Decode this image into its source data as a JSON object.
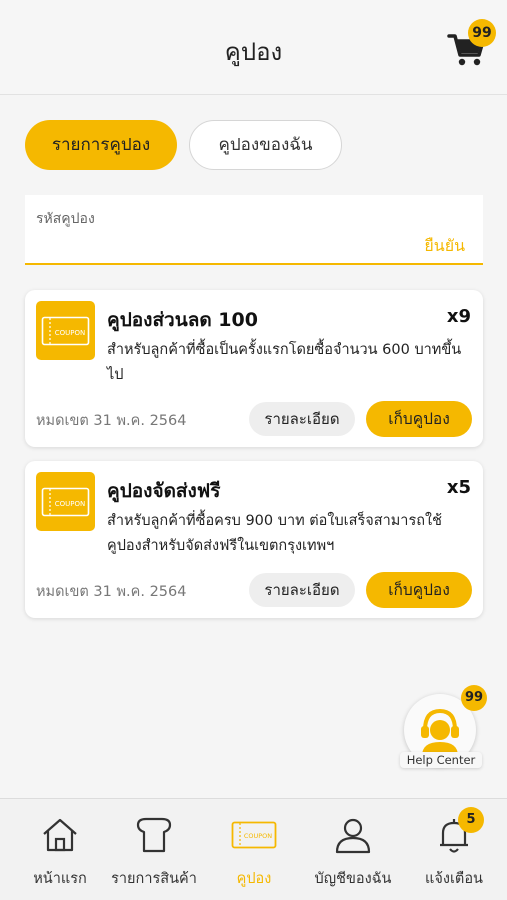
{
  "header": {
    "title": "คูปอง",
    "cart_icon": "cart-icon",
    "cart_badge": "99"
  },
  "tabs": [
    {
      "label": "รายการคูปอง",
      "active": true
    },
    {
      "label": "คูปองของฉัน",
      "active": false
    }
  ],
  "code_input": {
    "placeholder": "รหัสคูปอง",
    "confirm_label": "ยืนยัน"
  },
  "coupons": [
    {
      "title": "คูปองส่วนลด 100",
      "quantity": "x9",
      "description": "สำหรับลูกค้าที่ซื้อเป็นครั้งแรกโดยซื้อจำนวน 600 บาทขึ้นไป",
      "expiry": "หมดเขต 31 พ.ค. 2564",
      "detail_label": "รายละเอียด",
      "collect_label": "เก็บคูปอง",
      "icon_text": "COUPON"
    },
    {
      "title": "คูปองจัดส่งฟรี",
      "quantity": "x5",
      "description": "สำหรับลูกค้าที่ซื้อครบ 900 บาท ต่อใบเสร็จสามารถใช้คูปองสำหรับจัดส่งฟรีในเขตกรุงเทพฯ",
      "expiry": "หมดเขต 31 พ.ค. 2564",
      "detail_label": "รายละเอียด",
      "collect_label": "เก็บคูปอง",
      "icon_text": "COUPON"
    }
  ],
  "help_center": {
    "label": "Help Center",
    "badge": "99",
    "icon": "support-agent-icon"
  },
  "bottom_nav": [
    {
      "label": "หน้าแรก",
      "icon": "home-icon",
      "active": false
    },
    {
      "label": "รายการสินค้า",
      "icon": "bread-icon",
      "active": false
    },
    {
      "label": "คูปอง",
      "icon": "coupon-icon",
      "active": true,
      "icon_text": "COUPON"
    },
    {
      "label": "บัญชีของฉัน",
      "icon": "user-icon",
      "active": false
    },
    {
      "label": "แจ้งเตือน",
      "icon": "bell-icon",
      "active": false,
      "badge": "5"
    }
  ],
  "colors": {
    "accent": "#f5b800",
    "background": "#f5f5f5"
  }
}
